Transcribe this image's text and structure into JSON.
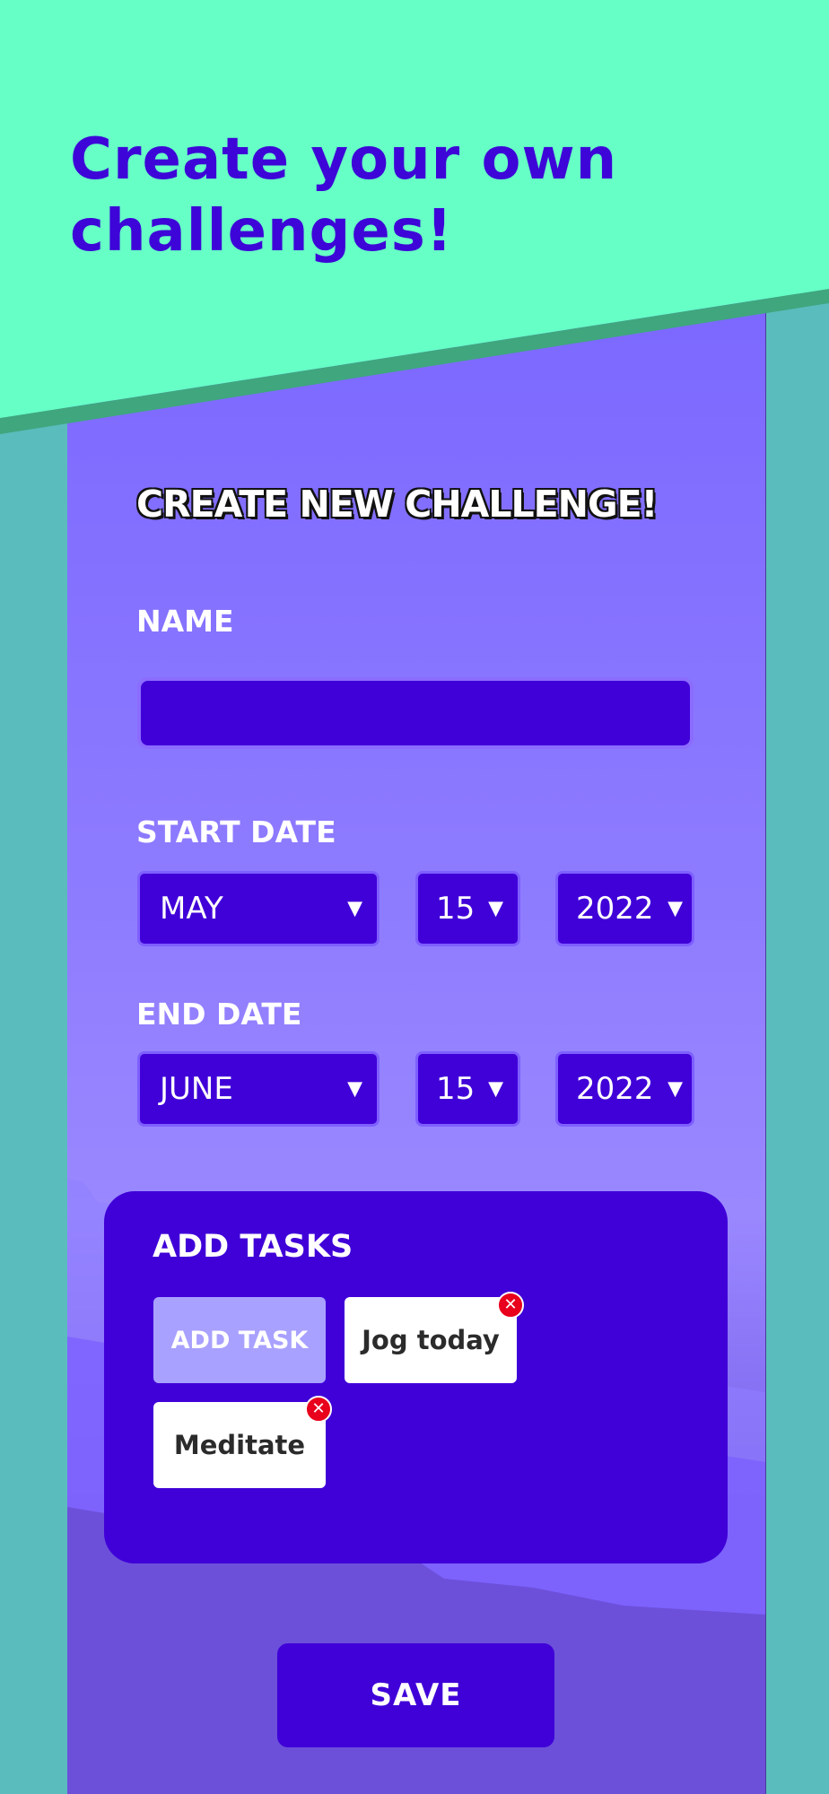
{
  "headline": "Create your own challenges!",
  "form": {
    "title": "CREATE NEW CHALLENGE!",
    "name_label": "NAME",
    "name_value": "",
    "start_label": "START DATE",
    "start": {
      "month": "MAY",
      "day": "15",
      "year": "2022"
    },
    "end_label": "END DATE",
    "end": {
      "month": "JUNE",
      "day": "15",
      "year": "2022"
    }
  },
  "tasks": {
    "title": "ADD TASKS",
    "add_label": "ADD TASK",
    "items": [
      "Jog today",
      "Meditate"
    ]
  },
  "save_label": "SAVE",
  "icons": {
    "dropdown": "caret-down-icon",
    "remove": "close-icon"
  },
  "colors": {
    "banner": "#66ffc6",
    "headline": "#3d05d8",
    "panel": "#4000d8",
    "background": "#5bbcbd",
    "remove_badge": "#e8001c"
  }
}
